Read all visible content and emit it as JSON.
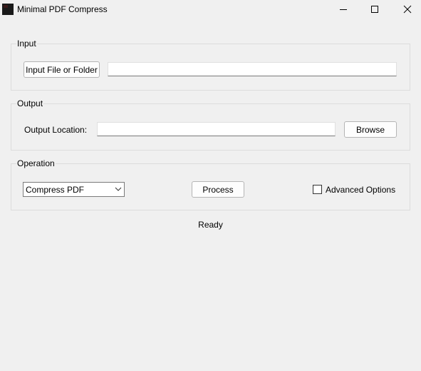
{
  "window": {
    "title": "Minimal PDF Compress",
    "icons": {
      "app": "app-icon",
      "minimize": "minimize-icon",
      "maximize": "maximize-icon",
      "close": "close-icon"
    }
  },
  "input_group": {
    "label": "Input",
    "button_label": "Input File or Folder",
    "path_value": ""
  },
  "output_group": {
    "label": "Output",
    "field_label": "Output Location:",
    "path_value": "",
    "browse_label": "Browse"
  },
  "operation_group": {
    "label": "Operation",
    "selected_operation": "Compress PDF",
    "process_label": "Process",
    "advanced_label": "Advanced Options",
    "advanced_checked": false
  },
  "status": {
    "text": "Ready"
  }
}
